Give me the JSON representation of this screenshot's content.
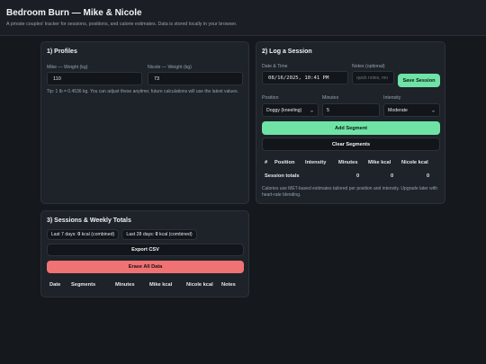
{
  "header": {
    "title": "Bedroom Burn — Mike & Nicole",
    "subtitle": "A private couples' tracker for sessions, positions, and calorie estimates. Data is stored locally in your browser."
  },
  "profiles": {
    "title": "1) Profiles",
    "mike_label": "Mike — Weight (kg)",
    "mike_value": "110",
    "nicole_label": "Nicole — Weight (kg)",
    "nicole_value": "73",
    "tip": "Tip: 1 lb = 0.4536 kg. You can adjust these anytime; future calculations will use the latest values."
  },
  "log": {
    "title": "2) Log a Session",
    "datetime_label": "Date & Time",
    "datetime_value": "08/16/2025, 10:41 PM",
    "notes_label": "Notes (optional)",
    "notes_placeholder": "quick notes, mo",
    "save_label": "Save Session",
    "position_label": "Position",
    "position_value": "Doggy (kneeling)",
    "minutes_label": "Minutes",
    "minutes_value": "5",
    "intensity_label": "Intensity",
    "intensity_value": "Moderate",
    "add_label": "Add Segment",
    "clear_label": "Clear Segments",
    "table_headers": [
      "#",
      "Position",
      "Intensity",
      "Minutes",
      "Mike kcal",
      "Nicole kcal"
    ],
    "totals_label": "Session totals",
    "totals_minutes": "0",
    "totals_mike": "0",
    "totals_nicole": "0",
    "note": "Calories use MET-based estimates tailored per position and intensity. Upgrade later with heart-rate blending."
  },
  "sessions": {
    "title": "3) Sessions & Weekly Totals",
    "last7_prefix": "Last 7 days:",
    "last7_value": "0",
    "last7_suffix": "kcal (combined)",
    "last28_prefix": "Last 28 days:",
    "last28_value": "0",
    "last28_suffix": "kcal (combined)",
    "export_label": "Export CSV",
    "erase_label": "Erase All Data",
    "table_headers": [
      "Date",
      "Segments",
      "Minutes",
      "Mike kcal",
      "Nicole kcal",
      "Notes"
    ]
  },
  "colors": {
    "accent_green": "#6ee3a5",
    "danger_red": "#f07272",
    "background": "#15181d",
    "card": "#1e232a"
  }
}
